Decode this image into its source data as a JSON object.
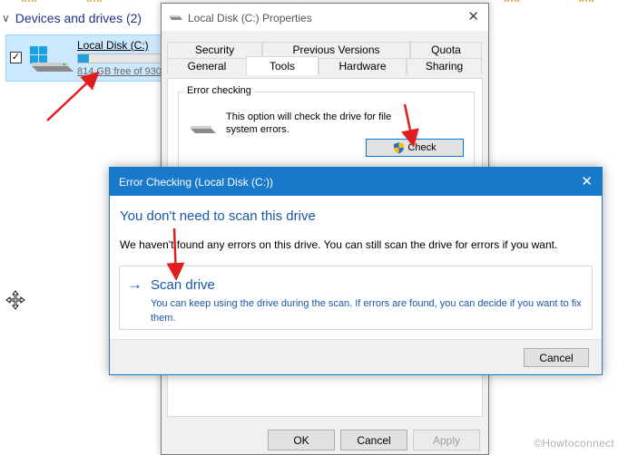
{
  "explorer": {
    "group_header": "Devices and drives (2)",
    "drive": {
      "name": "Local Disk (C:)",
      "free_text": "814 GB free of 930",
      "used_fraction": 0.12
    }
  },
  "properties": {
    "title": "Local Disk (C:) Properties",
    "tabs_row1": [
      "Security",
      "Previous Versions",
      "Quota"
    ],
    "tabs_row2": [
      "General",
      "Tools",
      "Hardware",
      "Sharing"
    ],
    "active_tab": "Tools",
    "error_checking": {
      "group_title": "Error checking",
      "description": "This option will check the drive for file system errors.",
      "check_label": "Check"
    },
    "buttons": {
      "ok": "OK",
      "cancel": "Cancel",
      "apply": "Apply"
    }
  },
  "error_dialog": {
    "title": "Error Checking (Local Disk (C:))",
    "heading": "You don't need to scan this drive",
    "body": "We haven't found any errors on this drive. You can still scan the drive for errors if you want.",
    "scan_title": "Scan drive",
    "scan_desc": "You can keep using the drive during the scan. If errors are found, you can decide if you want to fix them.",
    "cancel_label": "Cancel"
  },
  "watermark": "©Howtoconnect",
  "colors": {
    "accent": "#1979ca",
    "link_blue": "#1a56a8",
    "annotation_red": "#e11d1d",
    "selection": "#cce8ff"
  }
}
